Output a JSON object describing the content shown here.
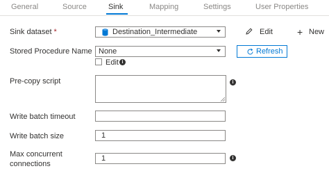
{
  "tabs": [
    {
      "label": "General"
    },
    {
      "label": "Source"
    },
    {
      "label": "Sink",
      "active": true
    },
    {
      "label": "Mapping"
    },
    {
      "label": "Settings"
    },
    {
      "label": "User Properties"
    }
  ],
  "sink_dataset": {
    "label": "Sink dataset",
    "required_marker": "*",
    "value": "Destination_Intermediate",
    "edit_label": "Edit",
    "new_label": "New",
    "new_symbol": "+"
  },
  "stored_procedure": {
    "label": "Stored Procedure Name",
    "value": "None",
    "edit_checkbox_label": "Edit",
    "edit_checked": false,
    "refresh_label": "Refresh"
  },
  "pre_copy_script": {
    "label": "Pre-copy script",
    "value": ""
  },
  "write_batch_timeout": {
    "label": "Write batch timeout",
    "value": ""
  },
  "write_batch_size": {
    "label": "Write batch size",
    "value": "1"
  },
  "max_concurrent": {
    "label_line1": "Max concurrent",
    "label_line2": "connections",
    "value": "1"
  },
  "info_glyph": "i",
  "colors": {
    "accent": "#0078d4",
    "required": "#a4262c",
    "text": "#323130",
    "muted": "#8a8886",
    "db_icon": "#0078d4"
  }
}
